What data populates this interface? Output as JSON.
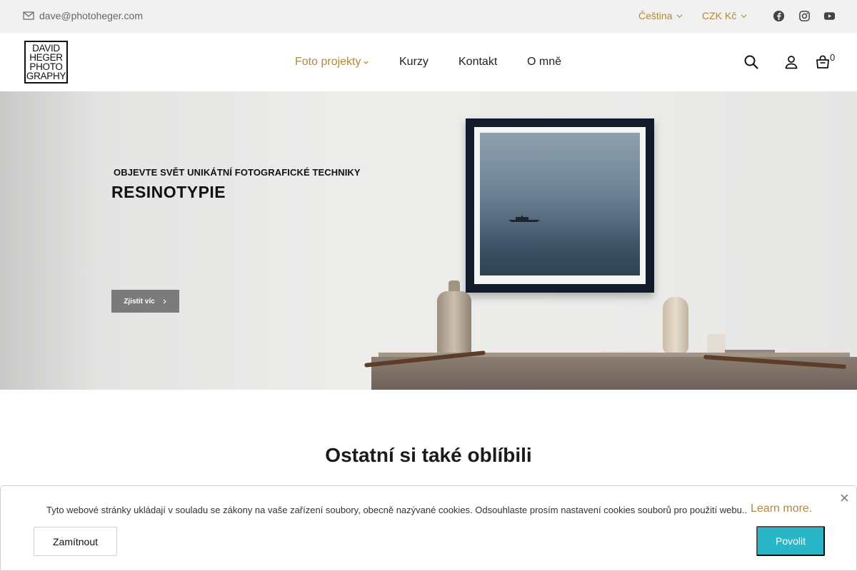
{
  "topbar": {
    "email": "dave@photoheger.com",
    "language": "Čeština",
    "currency": "CZK Kč",
    "social": [
      "facebook-icon",
      "instagram-icon",
      "youtube-icon"
    ],
    "accent_color": "#b08a3c"
  },
  "header": {
    "logo_lines": [
      "DAVID",
      "HEGER",
      "PHOTO",
      "GRAPHY"
    ],
    "nav": [
      {
        "label": "Foto projekty",
        "active": true,
        "has_dropdown": true
      },
      {
        "label": "Kurzy"
      },
      {
        "label": "Kontakt"
      },
      {
        "label": "O mně"
      }
    ],
    "icons": [
      "search-icon",
      "user-icon",
      "bag-icon"
    ],
    "cart_count": "0"
  },
  "hero": {
    "eyebrow": "OBJEVTE SVĚT UNIKÁTNÍ FOTOGRAFICKÉ TECHNIKY",
    "title": "RESINOTYPIE",
    "button_label": "Zjistit víc"
  },
  "section": {
    "title": "Ostatní si také oblíbili"
  },
  "cookie": {
    "text": "Tyto webové stránky ukládají v souladu se zákony na vaše zařízení soubory, obecně nazývané cookies. Odsouhlaste prosím nastavení cookies souborů pro použití webu..",
    "link": "Learn more.",
    "decline_label": "Zamítnout",
    "allow_label": "Povolit",
    "close_glyph": "×",
    "allow_color": "#28b6c8"
  }
}
